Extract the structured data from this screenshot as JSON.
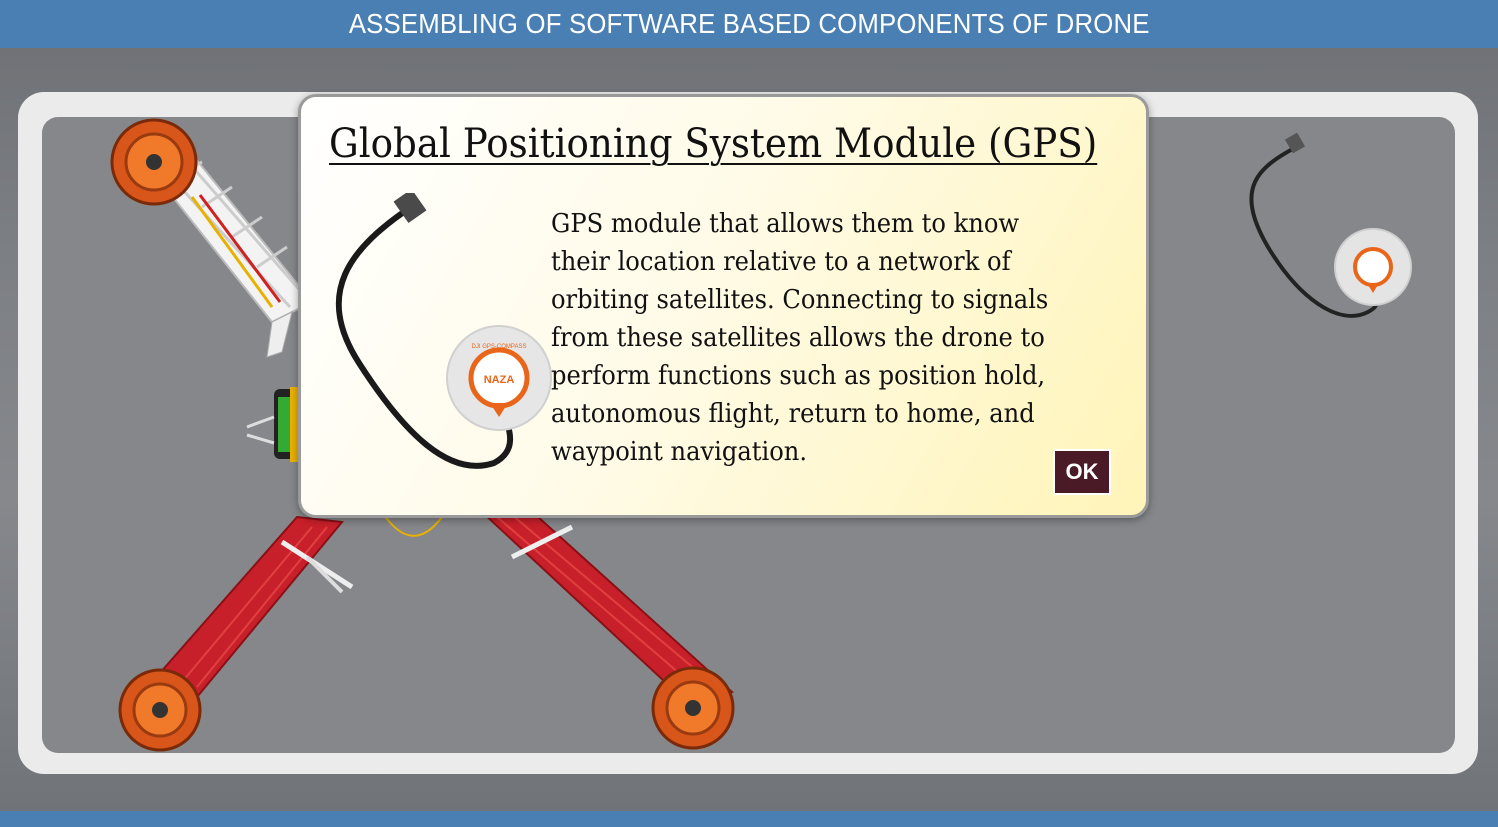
{
  "header": {
    "title": "ASSEMBLING OF SOFTWARE BASED COMPONENTS OF DRONE"
  },
  "modal": {
    "title": "Global Positioning System Module (GPS)",
    "description": "GPS module that allows them to know their location relative to a network of orbiting satellites. Connecting to signals from these satellites allows the drone to perform functions such as position hold, autonomous flight, return to home, and waypoint navigation.",
    "ok_label": "OK"
  },
  "gps_module": {
    "brand": "NAZA",
    "subtext": "DJI GPS-COMPASS"
  },
  "colors": {
    "header_bar": "#4a7fb3",
    "stage": "#85878a",
    "ok_button": "#4a1a26",
    "arm_red": "#c8202a",
    "motor_orange": "#e8651a"
  }
}
